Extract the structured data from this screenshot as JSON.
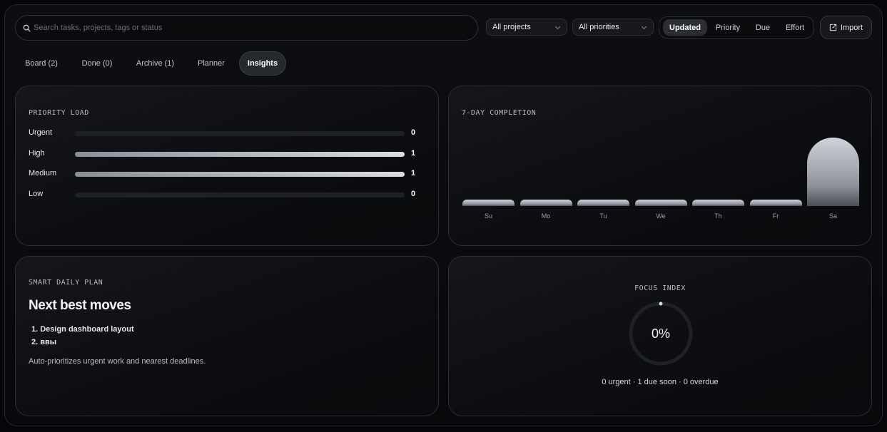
{
  "search": {
    "placeholder": "Search tasks, projects, tags or status",
    "icon": "search-icon"
  },
  "filters": {
    "projects": "All projects",
    "priorities": "All priorities"
  },
  "sort": {
    "options": [
      "Updated",
      "Priority",
      "Due",
      "Effort"
    ],
    "active": "Updated"
  },
  "import_label": "Import",
  "tabs": [
    "Board (2)",
    "Done (0)",
    "Archive (1)",
    "Planner",
    "Insights"
  ],
  "active_tab": "Insights",
  "priority_load": {
    "title": "PRIORITY LOAD",
    "rows": [
      {
        "label": "Urgent",
        "count": "0",
        "fill": 0
      },
      {
        "label": "High",
        "count": "1",
        "fill": 1
      },
      {
        "label": "Medium",
        "count": "1",
        "fill": 1
      },
      {
        "label": "Low",
        "count": "0",
        "fill": 0
      }
    ]
  },
  "completion": {
    "title": "7-DAY COMPLETION",
    "chart_data": {
      "type": "bar",
      "categories": [
        "Su",
        "Mo",
        "Tu",
        "We",
        "Th",
        "Fr",
        "Sa"
      ],
      "values": [
        0,
        0,
        0,
        0,
        0,
        0,
        1
      ]
    }
  },
  "daily_plan": {
    "title": "SMART DAILY PLAN",
    "heading": "Next best moves",
    "items": [
      "1. Design dashboard layout",
      "2. ввы"
    ],
    "note": "Auto-prioritizes urgent work and nearest deadlines."
  },
  "focus": {
    "title": "FOCUS INDEX",
    "value": "0%",
    "fraction": 0,
    "stats": "0 urgent · 1 due soon · 0 overdue"
  },
  "colors": {
    "background": "#050607",
    "accent": "#d9dce2",
    "text": "#e6e8ec"
  }
}
